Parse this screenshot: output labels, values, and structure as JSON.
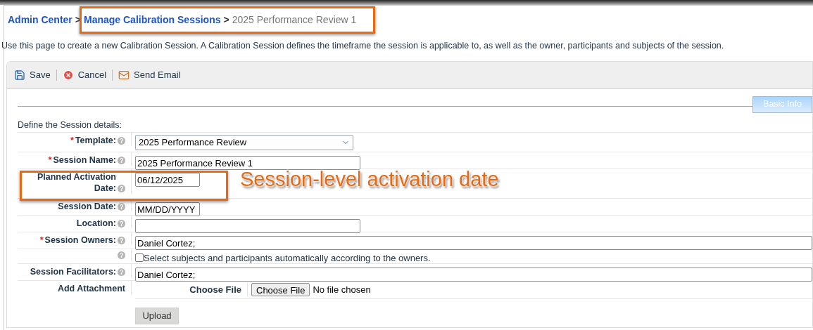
{
  "breadcrumb": [
    {
      "label": "Admin Center",
      "kind": "link"
    },
    {
      "label": "Manage Calibration Sessions",
      "kind": "link"
    },
    {
      "label": "2025 Performance Review 1",
      "kind": "current"
    }
  ],
  "separator": ">",
  "description": "Use this page to create a new Calibration Session. A Calibration Session defines the timeframe the session is applicable to, as well as the owner, participants and subjects of the session.",
  "toolbar": [
    {
      "label": "Save",
      "kind": "save"
    },
    {
      "label": "Cancel",
      "kind": "cancel"
    },
    {
      "label": "Send Email",
      "kind": "email"
    }
  ],
  "tabs": [
    {
      "label": "Basic Info",
      "selected": true
    }
  ],
  "section_title": "Define the Session details:",
  "fields": [
    {
      "kind": "select",
      "label": "Template:",
      "required_marker": "*",
      "help": true,
      "value": "2025 Performance Review"
    },
    {
      "kind": "text",
      "label": "Session Name:",
      "required_marker": "*",
      "help": true,
      "value": "2025 Performance Review 1"
    },
    {
      "kind": "date",
      "label": "Planned Activation Date:",
      "help": true,
      "value": "06/12/2025",
      "highlighted": true
    },
    {
      "kind": "date",
      "label": "Session Date:",
      "help": true,
      "value": "MM/DD/YYYY"
    },
    {
      "kind": "text",
      "label": "Location:",
      "help": true
    },
    {
      "kind": "wide_text",
      "label": "Session Owners:",
      "required_marker": "*",
      "help": true,
      "value": "Daniel Cortez;"
    },
    {
      "kind": "checkbox",
      "help": true,
      "checked": false,
      "text": "Select subjects and participants automatically according to the owners."
    },
    {
      "kind": "wide_text",
      "label": "Session Facilitators:",
      "help": true,
      "value": "Daniel Cortez;"
    },
    {
      "kind": "file",
      "label": "Add Attachment",
      "file_label": "Choose File",
      "button": "Choose File",
      "status": "No file chosen",
      "upload": "Upload"
    }
  ],
  "annotation": {
    "text": "Session-level activation date"
  }
}
